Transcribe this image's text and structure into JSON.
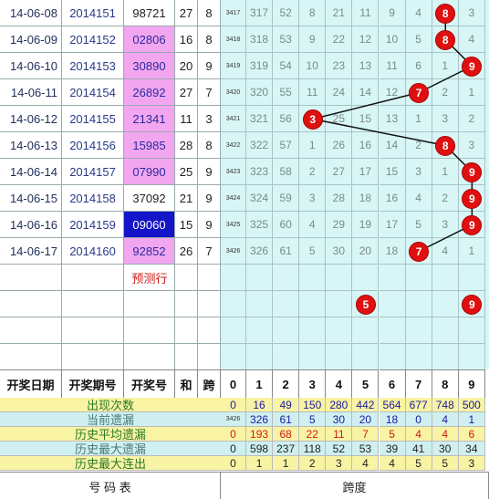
{
  "rows": [
    {
      "date": "14-06-08",
      "issue": "2014151",
      "number": "98721",
      "sum": "27",
      "span": "8",
      "idx": "3417",
      "cells": [
        "317",
        "52",
        "8",
        "21",
        "11",
        "9",
        "4",
        "",
        "3"
      ],
      "hl": ""
    },
    {
      "date": "14-06-09",
      "issue": "2014152",
      "number": "02806",
      "sum": "16",
      "span": "8",
      "idx": "3418",
      "cells": [
        "318",
        "53",
        "9",
        "22",
        "12",
        "10",
        "5",
        "",
        "4"
      ],
      "hl": "pink"
    },
    {
      "date": "14-06-10",
      "issue": "2014153",
      "number": "30890",
      "sum": "20",
      "span": "9",
      "idx": "3419",
      "cells": [
        "319",
        "54",
        "10",
        "23",
        "13",
        "11",
        "6",
        "1",
        ""
      ],
      "hl": "pink"
    },
    {
      "date": "14-06-11",
      "issue": "2014154",
      "number": "26892",
      "sum": "27",
      "span": "7",
      "idx": "3420",
      "cells": [
        "320",
        "55",
        "11",
        "24",
        "14",
        "12",
        "",
        "2",
        "1"
      ],
      "hl": "pink"
    },
    {
      "date": "14-06-12",
      "issue": "2014155",
      "number": "21341",
      "sum": "11",
      "span": "3",
      "idx": "3421",
      "cells": [
        "321",
        "56",
        "",
        "25",
        "15",
        "13",
        "1",
        "3",
        "2"
      ],
      "hl": "pink"
    },
    {
      "date": "14-06-13",
      "issue": "2014156",
      "number": "15985",
      "sum": "28",
      "span": "8",
      "idx": "3422",
      "cells": [
        "322",
        "57",
        "1",
        "26",
        "16",
        "14",
        "2",
        "",
        "3"
      ],
      "hl": "pink"
    },
    {
      "date": "14-06-14",
      "issue": "2014157",
      "number": "07990",
      "sum": "25",
      "span": "9",
      "idx": "3423",
      "cells": [
        "323",
        "58",
        "2",
        "27",
        "17",
        "15",
        "3",
        "1",
        ""
      ],
      "hl": "pink"
    },
    {
      "date": "14-06-15",
      "issue": "2014158",
      "number": "37092",
      "sum": "21",
      "span": "9",
      "idx": "3424",
      "cells": [
        "324",
        "59",
        "3",
        "28",
        "18",
        "16",
        "4",
        "2",
        ""
      ],
      "hl": ""
    },
    {
      "date": "14-06-16",
      "issue": "2014159",
      "number": "09060",
      "sum": "15",
      "span": "9",
      "idx": "3425",
      "cells": [
        "325",
        "60",
        "4",
        "29",
        "19",
        "17",
        "5",
        "3",
        ""
      ],
      "hl": "blue"
    },
    {
      "date": "14-06-17",
      "issue": "2014160",
      "number": "92852",
      "sum": "26",
      "span": "7",
      "idx": "3426",
      "cells": [
        "326",
        "61",
        "5",
        "30",
        "20",
        "18",
        "",
        "4",
        "1"
      ],
      "hl": "pink"
    }
  ],
  "balls": [
    {
      "row": 0,
      "col": 8,
      "value": "8"
    },
    {
      "row": 1,
      "col": 8,
      "value": "8"
    },
    {
      "row": 2,
      "col": 9,
      "value": "9"
    },
    {
      "row": 3,
      "col": 7,
      "value": "7"
    },
    {
      "row": 4,
      "col": 3,
      "value": "3"
    },
    {
      "row": 5,
      "col": 8,
      "value": "8"
    },
    {
      "row": 6,
      "col": 9,
      "value": "9"
    },
    {
      "row": 7,
      "col": 9,
      "value": "9"
    },
    {
      "row": 8,
      "col": 9,
      "value": "9"
    },
    {
      "row": 9,
      "col": 7,
      "value": "7"
    }
  ],
  "prediction": {
    "label": "预测行",
    "balls": [
      {
        "col": 5,
        "value": "5"
      },
      {
        "col": 9,
        "value": "9"
      }
    ]
  },
  "headers": {
    "date": "开奖日期",
    "issue": "开奖期号",
    "number": "开奖号",
    "sum": "和",
    "span": "跨",
    "digits": [
      "0",
      "1",
      "2",
      "3",
      "4",
      "5",
      "6",
      "7",
      "8",
      "9"
    ]
  },
  "stats": [
    {
      "label": "出现次数",
      "label_color": "#2a7a2a",
      "bg": "#f9f3a4",
      "color": "#1a1aa0",
      "idx": "",
      "values": [
        "0",
        "16",
        "49",
        "150",
        "280",
        "442",
        "564",
        "677",
        "748",
        "500"
      ]
    },
    {
      "label": "当前遗漏",
      "label_color": "#4a7a7a",
      "bg": "#cfeff0",
      "color": "#1a1aa0",
      "idx": "3426",
      "values": [
        "",
        "326",
        "61",
        "5",
        "30",
        "20",
        "18",
        "0",
        "4",
        "1"
      ]
    },
    {
      "label": "历史平均遗漏",
      "label_color": "#2a7a2a",
      "bg": "#f9f3a4",
      "color": "#d01818",
      "idx": "",
      "values": [
        "0",
        "193",
        "68",
        "22",
        "11",
        "7",
        "5",
        "4",
        "4",
        "6"
      ]
    },
    {
      "label": "历史最大遗漏",
      "label_color": "#4a7a7a",
      "bg": "#cfeff0",
      "color": "#222222",
      "idx": "",
      "values": [
        "0",
        "598",
        "237",
        "118",
        "52",
        "53",
        "39",
        "41",
        "30",
        "34"
      ]
    },
    {
      "label": "历史最大连出",
      "label_color": "#2a7a2a",
      "bg": "#f9f3a4",
      "color": "#222222",
      "idx": "",
      "values": [
        "0",
        "1",
        "1",
        "2",
        "3",
        "4",
        "4",
        "5",
        "5",
        "3"
      ]
    }
  ],
  "footer": {
    "left": "号 码 表",
    "right": "跨度"
  },
  "colors": {
    "ball": "#e01010",
    "pink": "#f3a6f0",
    "blue_highlight": "#1414c8",
    "grid_bg": "#d8f6f6"
  }
}
